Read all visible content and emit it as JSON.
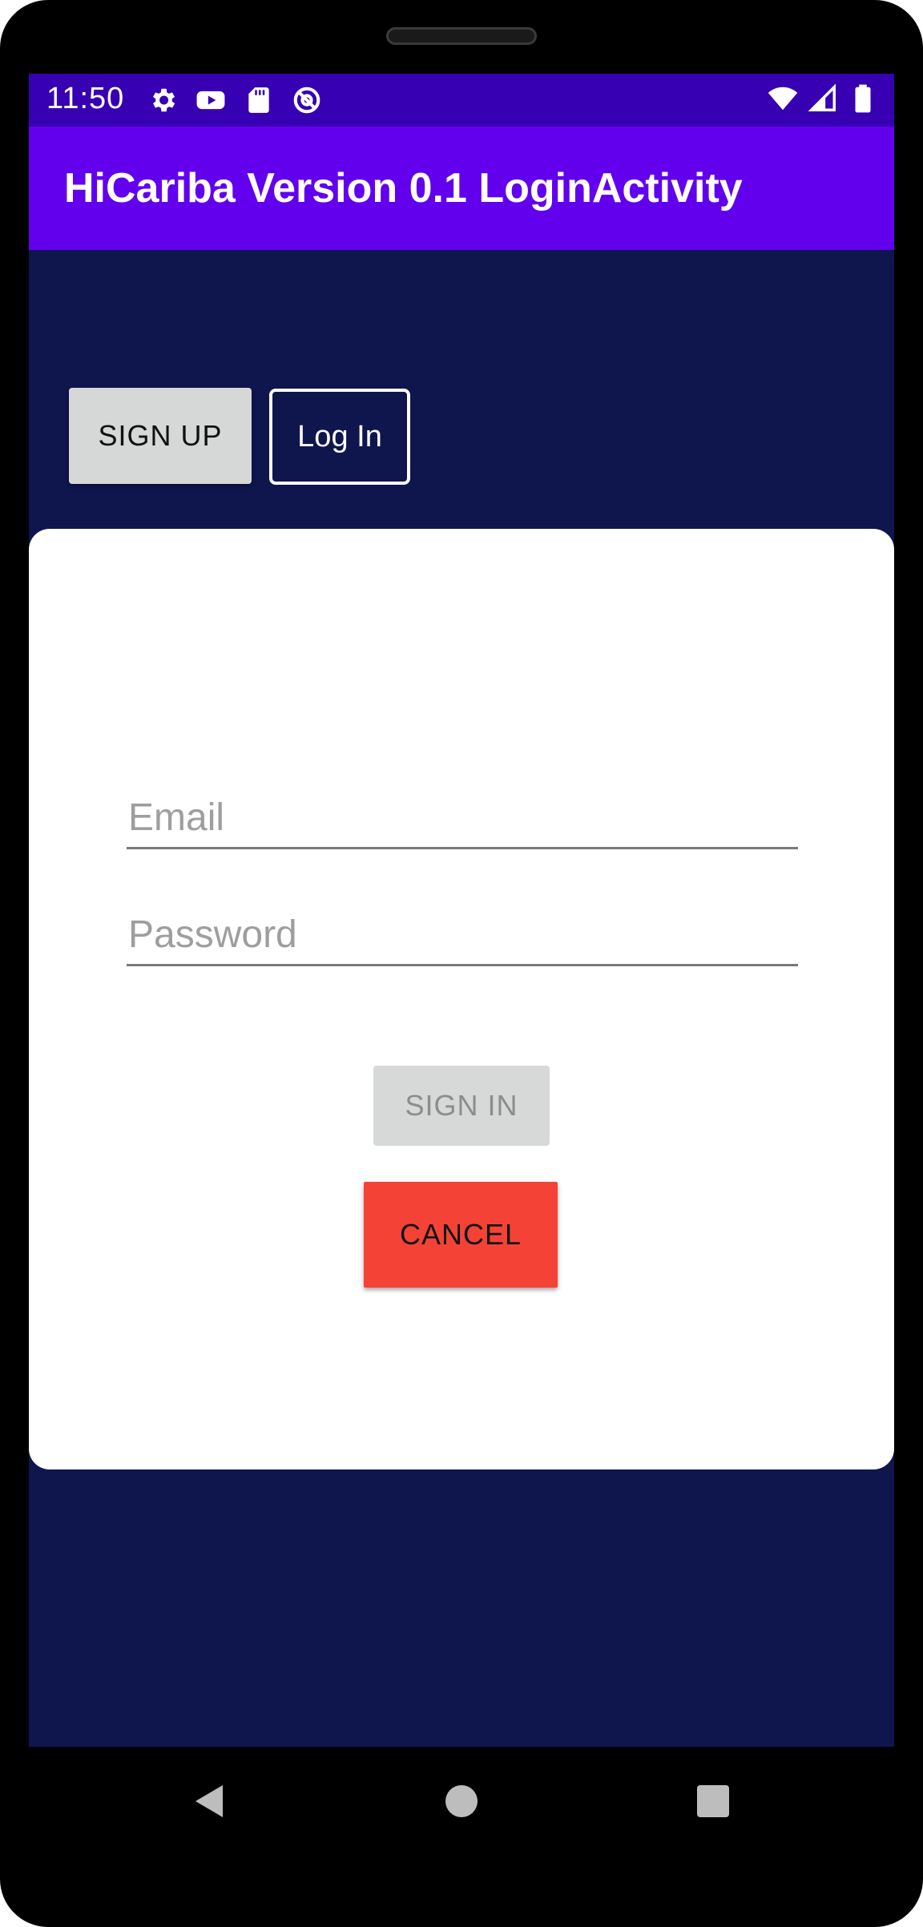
{
  "status_bar": {
    "time": "11:50",
    "left_icons": [
      "settings-icon",
      "youtube-icon",
      "sd-card-icon",
      "at-sign-icon"
    ],
    "right_icons": [
      "wifi-icon",
      "signal-icon",
      "battery-icon"
    ]
  },
  "app_bar": {
    "title": "HiCariba Version 0.1 LoginActivity"
  },
  "top_buttons": {
    "signup_label": "SIGN UP",
    "login_label": "Log In"
  },
  "form": {
    "email_placeholder": "Email",
    "email_value": "",
    "password_placeholder": "Password",
    "password_value": "",
    "signin_label": "SIGN IN",
    "cancel_label": "CANCEL"
  },
  "navigation": {
    "items": [
      "back-icon",
      "home-icon",
      "recents-icon"
    ]
  },
  "colors": {
    "status_bar": "#3700b3",
    "app_bar": "#6200ee",
    "background": "#0f154d",
    "card": "#ffffff",
    "cancel": "#f44336",
    "disabled_button": "#d7d8d8"
  }
}
